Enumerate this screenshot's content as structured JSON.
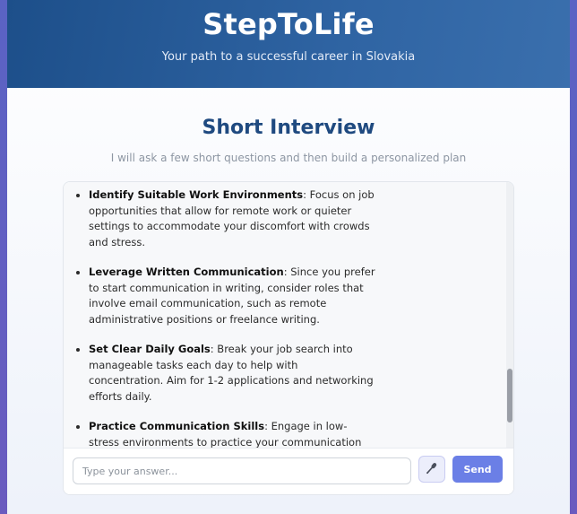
{
  "header": {
    "title": "StepToLife",
    "tagline": "Your path to a successful career in Slovakia"
  },
  "main": {
    "title": "Short Interview",
    "subtitle": "I will ask a few short questions and then build a personalized plan"
  },
  "chat": {
    "items": [
      {
        "heading": "Identify Suitable Work Environments",
        "text": ": Focus on job opportunities that allow for remote work or quieter settings to accommodate your discomfort with crowds and stress."
      },
      {
        "heading": "Leverage Written Communication",
        "text": ": Since you prefer to start communication in writing, consider roles that involve email communication, such as remote administrative positions or freelance writing."
      },
      {
        "heading": "Set Clear Daily Goals",
        "text": ": Break your job search into manageable tasks each day to help with concentration. Aim for 1-2 applications and networking efforts daily."
      },
      {
        "heading": "Practice Communication Skills",
        "text": ": Engage in low-stress environments to practice your communication skills, such as online forums or small group discussions, to build confidence."
      }
    ]
  },
  "input": {
    "placeholder": "Type your answer...",
    "value": "",
    "mic_icon": "microphone-icon",
    "send_label": "Send"
  }
}
